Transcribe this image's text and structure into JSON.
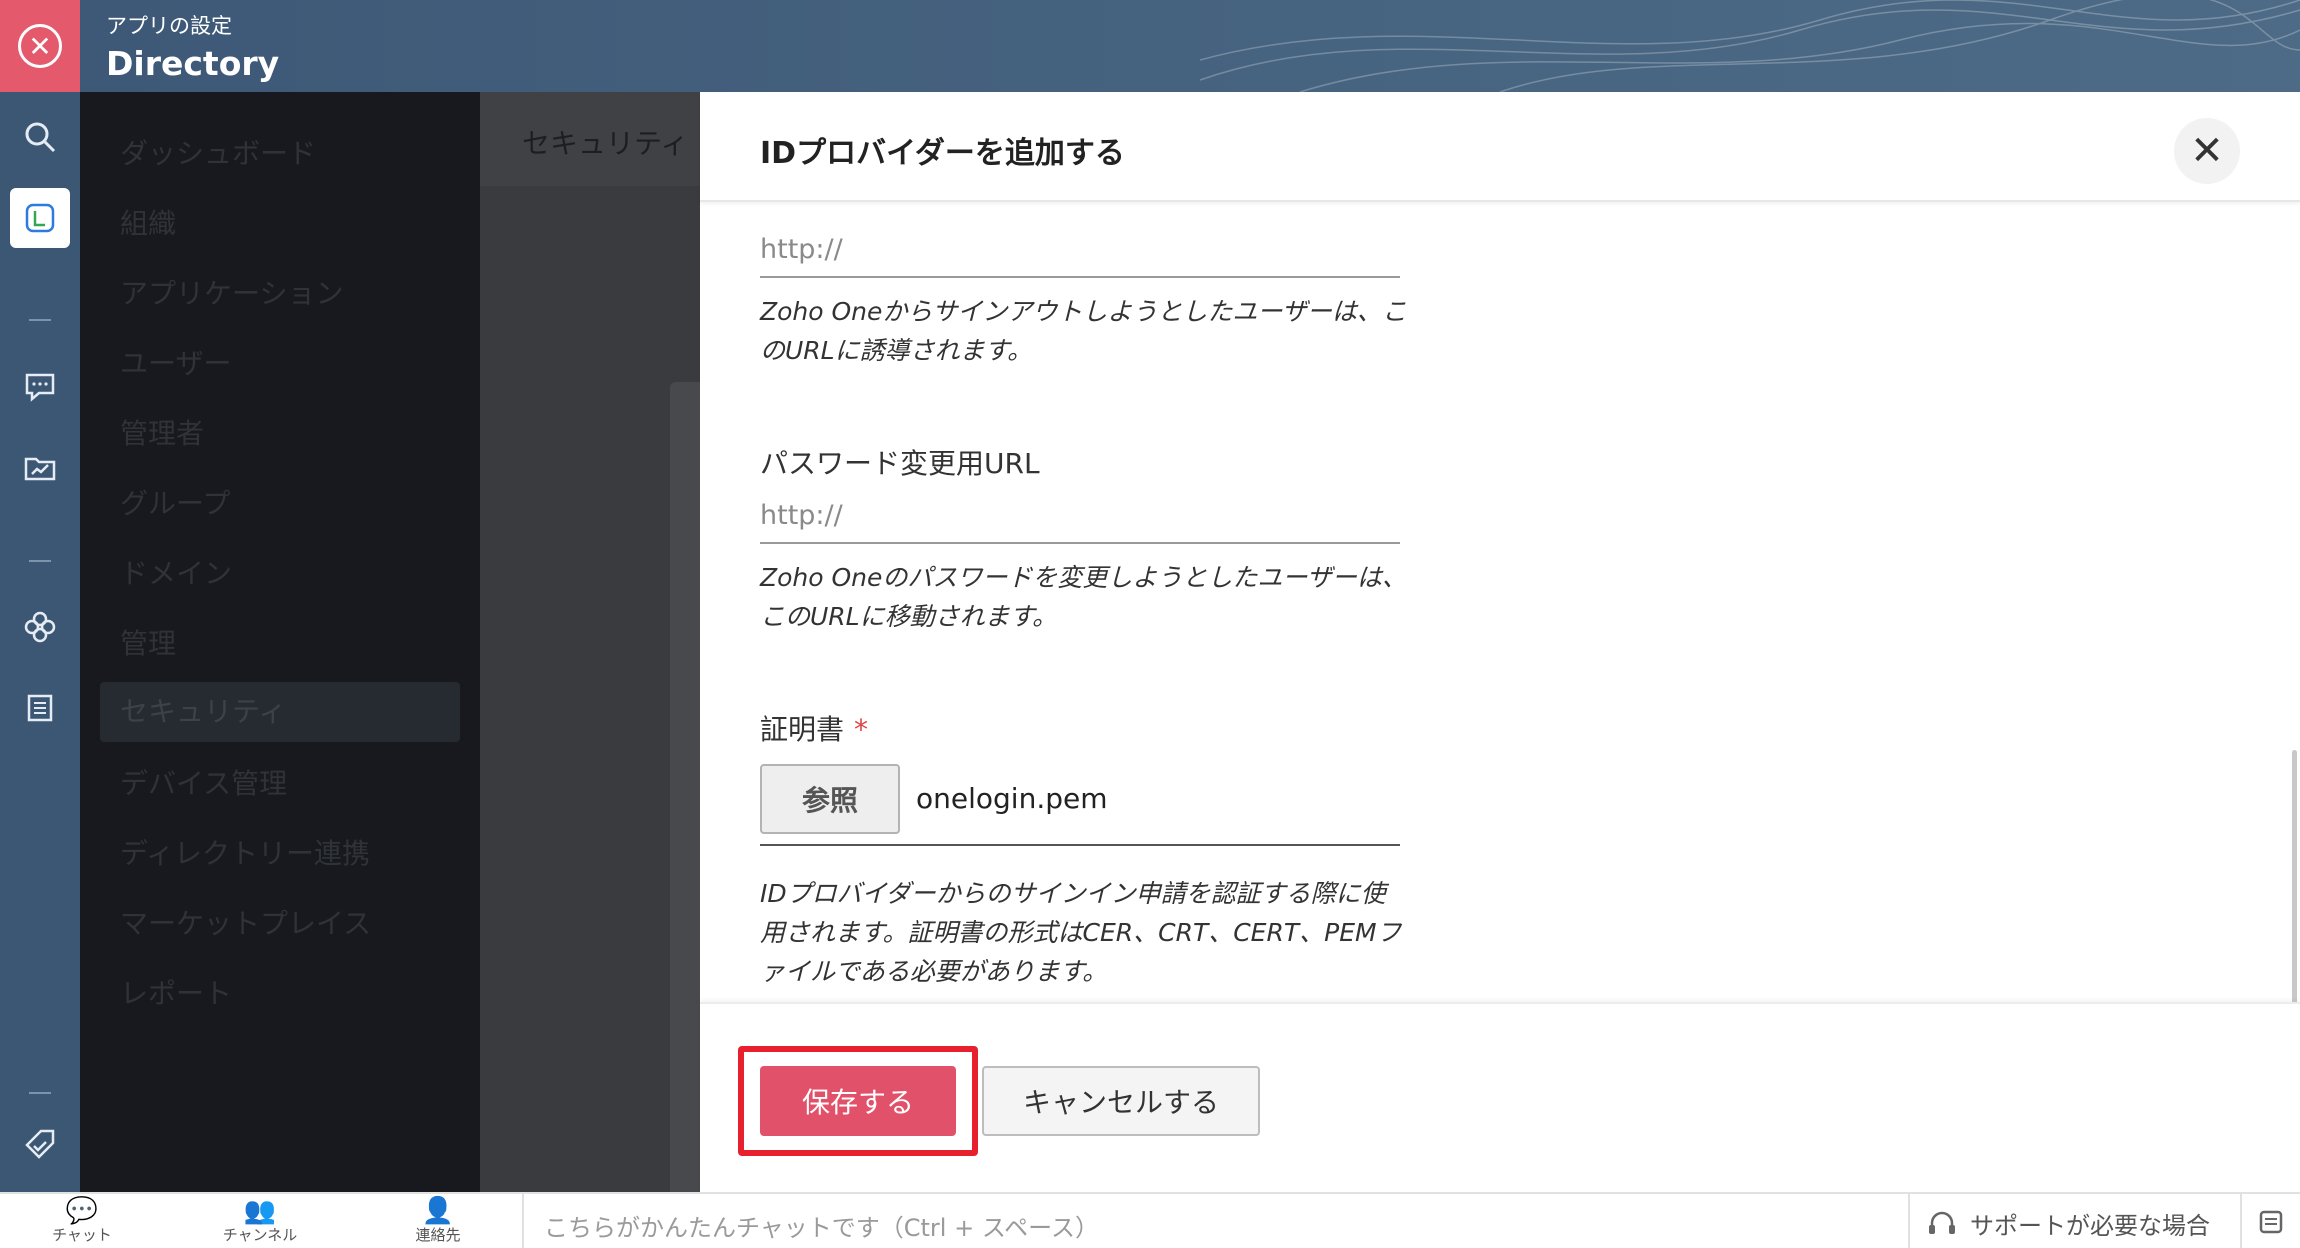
{
  "header": {
    "subtitle": "アプリの設定",
    "title": "Directory"
  },
  "nav": {
    "items": [
      "ダッシュボード",
      "組織",
      "アプリケーション",
      "ユーザー",
      "管理者",
      "グループ",
      "ドメイン",
      "管理",
      "セキュリティ",
      "デバイス管理",
      "ディレクトリー連携",
      "マーケットプレイス",
      "レポート"
    ],
    "selected": "セキュリティ"
  },
  "main": {
    "breadcrumb": "セキュリティ"
  },
  "modal": {
    "title": "IDプロバイダーを追加する",
    "logout_url": {
      "placeholder": "http://",
      "help": "Zoho Oneからサインアウトしようとしたユーザーは、このURLに誘導されます。"
    },
    "password_url": {
      "label": "パスワード変更用URL",
      "placeholder": "http://",
      "help": "Zoho Oneのパスワードを変更しようとしたユーザーは、このURLに移動されます。"
    },
    "certificate": {
      "label": "証明書",
      "required_mark": "*",
      "browse_label": "参照",
      "file_name": "onelogin.pem",
      "help": "IDプロバイダーからのサインイン申請を認証する際に使用されます。証明書の形式はCER、CRT、CERT、PEMファイルである必要があります。"
    },
    "save_label": "保存する",
    "cancel_label": "キャンセルする"
  },
  "bottombar": {
    "tabs": [
      "チャット",
      "チャンネル",
      "連絡先"
    ],
    "chat_placeholder": "こちらがかんたんチャットです（Ctrl + スペース）",
    "support_label": "サポートが必要な場合"
  },
  "colors": {
    "header_bg": "#3d5876",
    "close_corner": "#e45a6c",
    "save_button": "#e2516a",
    "highlight_outline": "#e8202e",
    "nav_bg": "#17191e"
  }
}
